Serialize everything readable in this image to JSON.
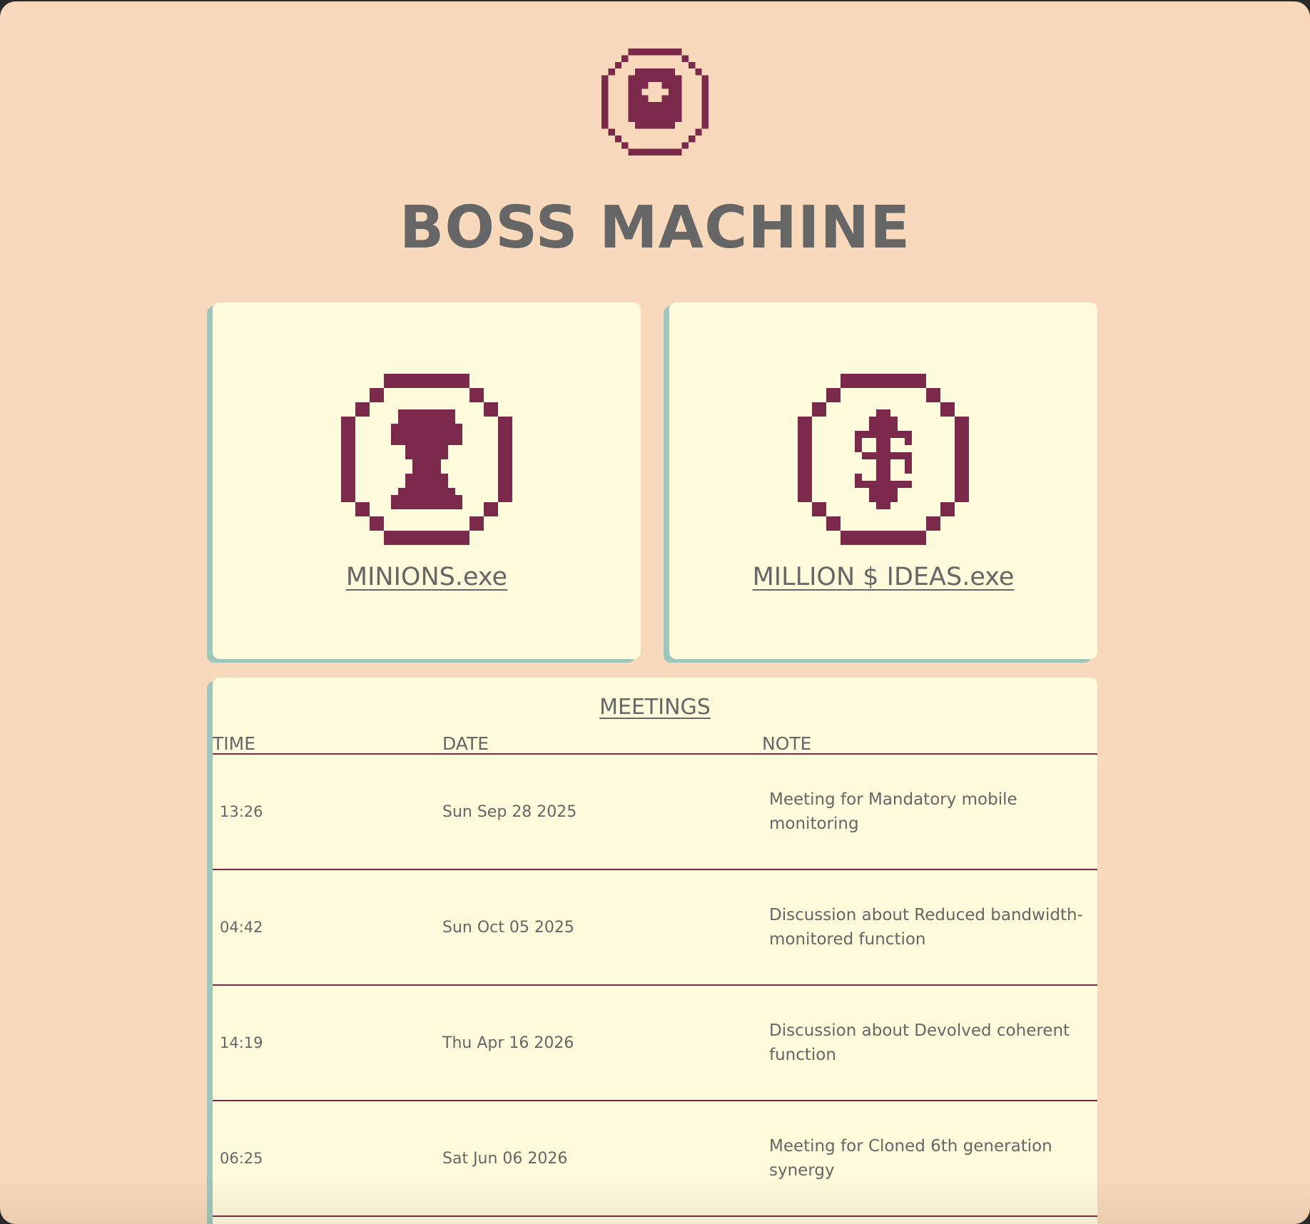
{
  "app": {
    "title": "BOSS MACHINE",
    "logo_icon": "eye-icon"
  },
  "cards": [
    {
      "label": "MINIONS.exe",
      "icon": "minion-icon"
    },
    {
      "label": "MILLION $ IDEAS.exe",
      "icon": "dollar-icon"
    }
  ],
  "meetings": {
    "title": "MEETINGS",
    "headers": {
      "time": "TIME",
      "date": "DATE",
      "note": "NOTE"
    },
    "rows": [
      {
        "time": "13:26",
        "date": "Sun Sep 28 2025",
        "note": "Meeting for Mandatory mobile monitoring"
      },
      {
        "time": "04:42",
        "date": "Sun Oct 05 2025",
        "note": "Discussion about Reduced bandwidth-monitored function"
      },
      {
        "time": "14:19",
        "date": "Thu Apr 16 2026",
        "note": "Discussion about Devolved coherent function"
      },
      {
        "time": "06:25",
        "date": "Sat Jun 06 2026",
        "note": "Meeting for Cloned 6th generation synergy"
      }
    ]
  },
  "colors": {
    "page_background": "#f9d9bb",
    "card_background": "#fefbdc",
    "card_shadow": "#9fc6bc",
    "icon_color": "#7b2a4b",
    "text_color": "#666666",
    "divider_color": "#7b2a4b"
  }
}
